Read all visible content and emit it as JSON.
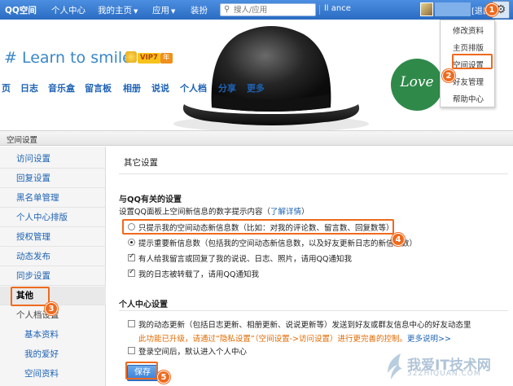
{
  "topbar": {
    "brand": "QQ空间",
    "nav": [
      "个人中心",
      "我的主页",
      "应用",
      "装扮"
    ],
    "caret": "▼",
    "search_placeholder": "搜人/应用",
    "username_prefix": "ll",
    "username": "ance",
    "logout": "[退出]",
    "colors": {
      "bar": "#3578d0",
      "highlight": "#ee6a1e"
    }
  },
  "dropdown": {
    "items": [
      "修改资料",
      "主页排版",
      "空间设置",
      "好友管理",
      "帮助中心"
    ],
    "cut_label": "空"
  },
  "banner": {
    "slogan": "# Learn to smile",
    "vip_badge": "VIP7",
    "vip_year": "年",
    "tabs": [
      "页",
      "日志",
      "音乐盒",
      "留言板",
      "相册",
      "说说",
      "个人档",
      "分享",
      "更多"
    ],
    "love_text": "Love"
  },
  "panel": {
    "title": "空间设置",
    "sidebar": {
      "items": [
        "访问设置",
        "回复设置",
        "黑名单管理",
        "个人中心排版",
        "授权管理",
        "动态发布",
        "同步设置",
        "其他"
      ],
      "active": "其他",
      "subgroup": "个人档设置",
      "subitems": [
        "基本资料",
        "我的爱好",
        "空间资料"
      ]
    },
    "content": {
      "title": "其它设置",
      "qq_section": {
        "heading": "与QQ有关的设置",
        "desc": "设置QQ面板上空间新信息的数字提示内容（",
        "desc_link": "了解详情",
        "desc_end": "）",
        "options": [
          {
            "type": "radio",
            "checked": false,
            "text": "只提示我的空间动态新信息数（比如：对我的评论数、留言数、回复数等）"
          },
          {
            "type": "radio",
            "checked": true,
            "text": "提示重要新信息数（包括我的空间动态新信息数，以及好友更新日志的新信息数）"
          },
          {
            "type": "checkbox",
            "checked": true,
            "text": "有人给我留言或回复了我的说说、日志、照片，请用QQ通知我"
          },
          {
            "type": "checkbox",
            "checked": true,
            "text": "我的日志被转载了，请用QQ通知我"
          }
        ]
      },
      "center_section": {
        "heading": "个人中心设置",
        "opt1": "我的动态更新（包括日志更新、相册更新、说说更新等）发送到好友或群友信息中心的好友动态里",
        "warn_text": "此功能已升级，请通过“隐私设置”（空间设置->访问设置）进行更完善的控制。",
        "warn_link": "更多说明>>",
        "opt2": "登录空间后，默认进入个人中心"
      },
      "save_label": "保存"
    }
  },
  "annotations": [
    "1",
    "2",
    "3",
    "4",
    "5"
  ],
  "watermark": {
    "brand": "我爱IT技术网",
    "url": "52ZHIQUAN.COM"
  }
}
